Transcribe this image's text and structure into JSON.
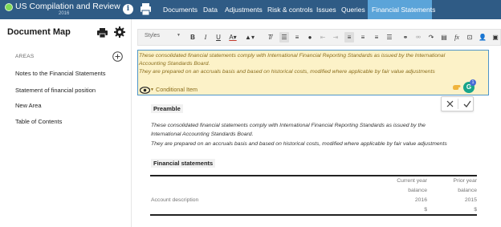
{
  "app": {
    "title": "US Compilation and Review",
    "year": "2016"
  },
  "nav": {
    "items": [
      {
        "label": "Documents"
      },
      {
        "label": "Data"
      },
      {
        "label": "Adjustments"
      },
      {
        "label": "Risk & controls"
      },
      {
        "label": "Issues"
      },
      {
        "label": "Queries"
      },
      {
        "label": "Financial Statements",
        "active": true
      }
    ]
  },
  "sidebar": {
    "title": "Document Map",
    "areas_label": "AREAS",
    "items": [
      {
        "label": "Notes to the Financial Statements"
      },
      {
        "label": "Statement of financial position"
      },
      {
        "label": "New Area"
      },
      {
        "label": "Table of Contents"
      }
    ]
  },
  "toolbar": {
    "styles_label": "Styles"
  },
  "editor": {
    "conditional": {
      "line1": "These consolidated financial statements comply with International Financial Reporting Standards as issued by the International",
      "line2": "Accounting Standards Board.",
      "line3": "They are prepared on an accruals basis and based on historical costs, modified where applicable by fair value adjustments",
      "label": "Conditional Item",
      "badge_count": "1",
      "g_letter": "G"
    },
    "preamble": {
      "title": "Preamble",
      "line1": "These consolidated financial statements comply with International Financial Reporting Standards as issued by the",
      "line2": "International Accounting Standards Board.",
      "line3": "They are prepared on an accruals basis and based on historical costs, modified where applicable by fair value adjustments"
    },
    "financial_statements": {
      "title": "Financial statements",
      "account_description": "Account description",
      "columns": [
        {
          "line1": "Current year",
          "line2": "balance",
          "year": "2016",
          "unit": "$"
        },
        {
          "line1": "Prior year",
          "line2": "balance",
          "year": "2015",
          "unit": "$"
        }
      ]
    }
  },
  "colors": {
    "topbar": "#2f5b85",
    "active_tab": "#5ba4d9",
    "conditional_bg": "#fcf2c8",
    "conditional_text": "#8a6d1c",
    "selection_border": "#4e95c9"
  }
}
